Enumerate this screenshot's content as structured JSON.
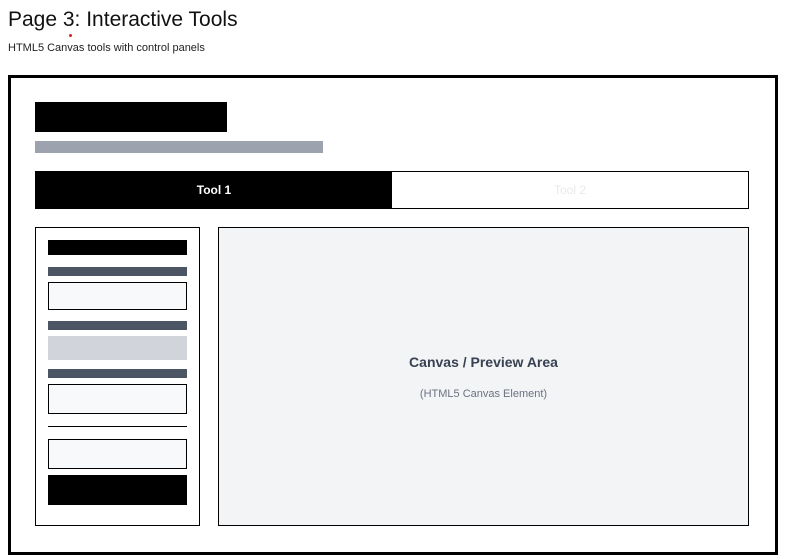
{
  "page": {
    "title": "Page 3: Interactive Tools",
    "subtitle": "HTML5 Canvas tools with control panels"
  },
  "tabs": [
    {
      "label": "Tool 1",
      "active": true
    },
    {
      "label": "Tool 2",
      "active": false
    }
  ],
  "canvas": {
    "title": "Canvas / Preview Area",
    "subtitle": "(HTML5 Canvas Element)"
  },
  "colors": {
    "frame_border": "#000000",
    "placeholder_gray": "#9ca3af",
    "label_bar": "#4b5563",
    "slider_fill": "#d1d5db",
    "input_fill": "#f8f9fa",
    "canvas_bg": "#f3f4f6"
  }
}
